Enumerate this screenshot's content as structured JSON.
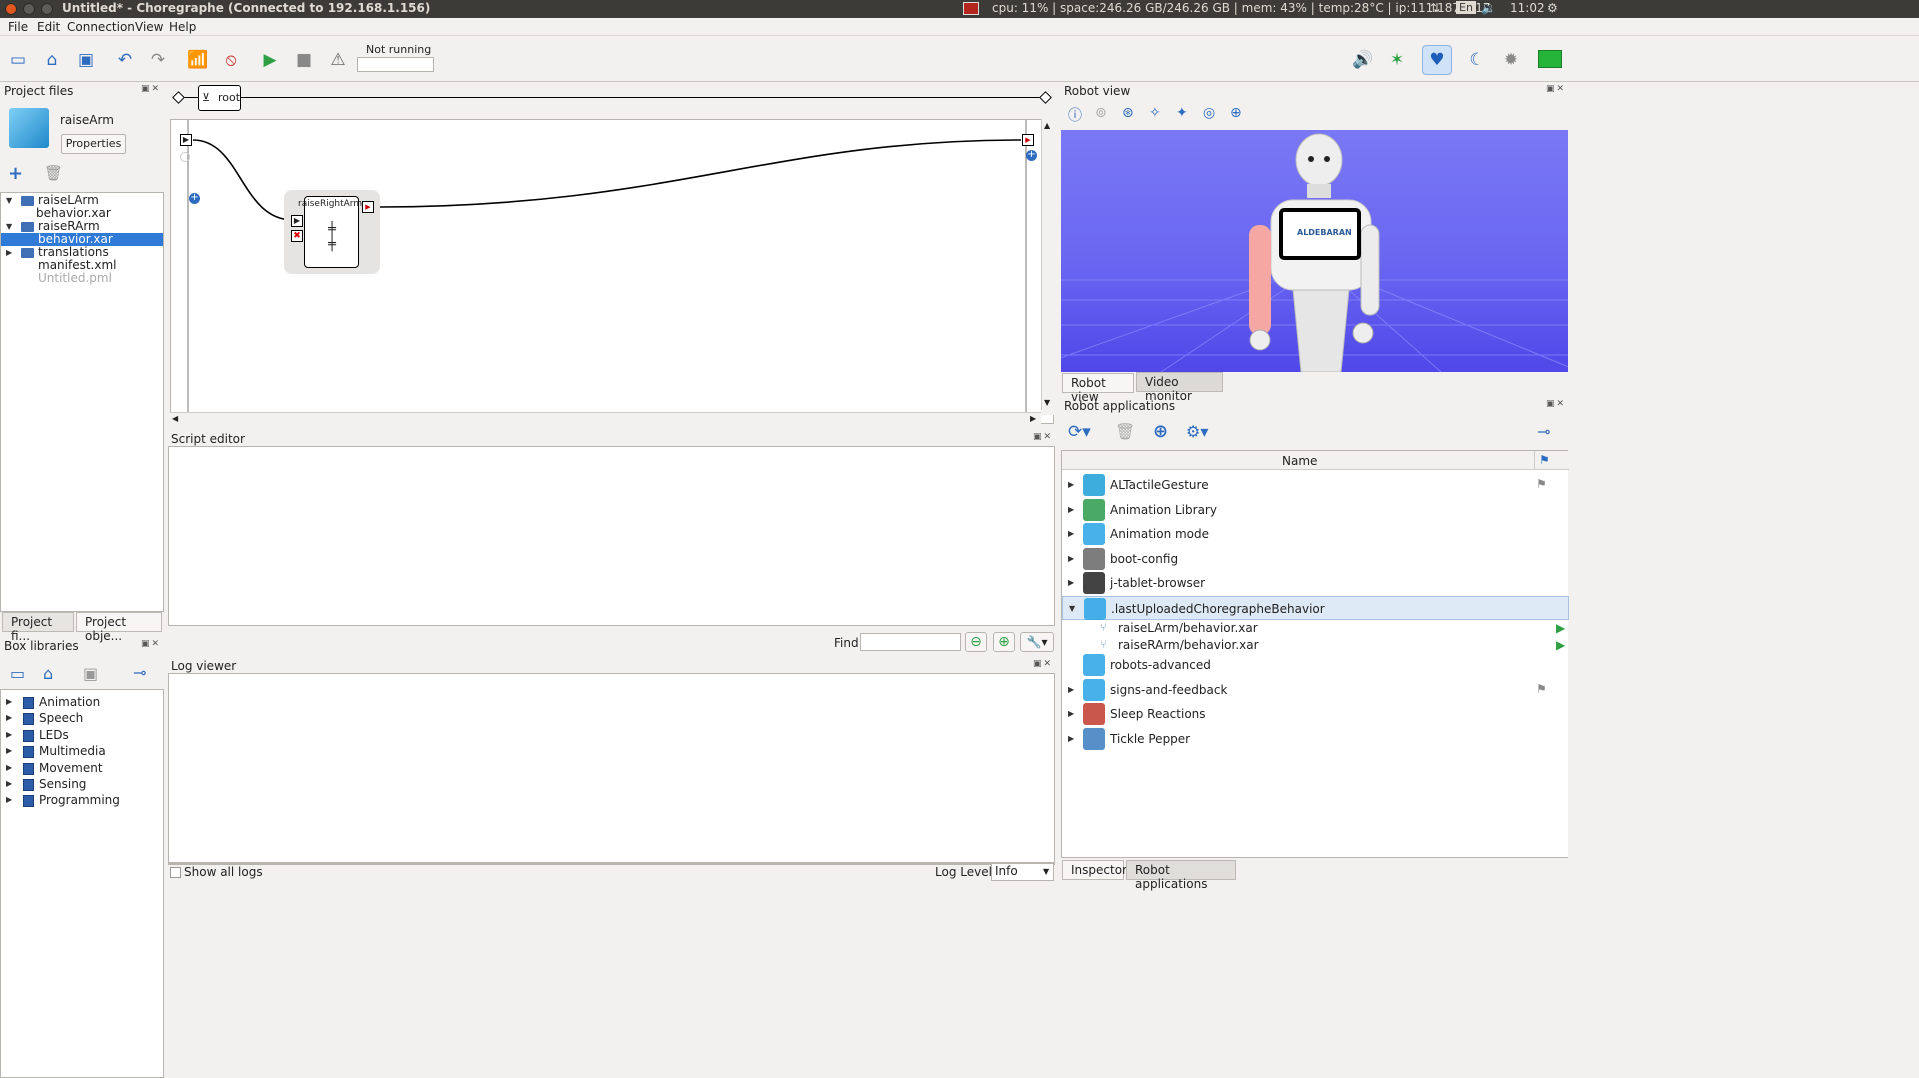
{
  "window": {
    "title": "Untitled* - Choregraphe (Connected to 192.168.1.156)",
    "tray_status": "cpu: 11% | space:246.26 GB/246.26 GB | mem: 43% | temp:28°C | ip:111.187.7.17",
    "tray_lang": "En",
    "tray_time": "11:02"
  },
  "menu": {
    "file": "File",
    "edit": "Edit",
    "connection": "Connection",
    "view": "View",
    "help": "Help"
  },
  "toolbar": {
    "status": "Not running"
  },
  "project_files": {
    "title": "Project files",
    "project_name": "raiseArm",
    "properties_button": "Properties",
    "tree": [
      {
        "label": "raiseLArm",
        "kind": "folder",
        "expanded": true,
        "indent": 0
      },
      {
        "label": "behavior.xar",
        "kind": "file",
        "indent": 1
      },
      {
        "label": "raiseRArm",
        "kind": "folder",
        "expanded": true,
        "indent": 0
      },
      {
        "label": "behavior.xar",
        "kind": "file",
        "indent": 1,
        "selected": true
      },
      {
        "label": "translations",
        "kind": "folder",
        "expanded": false,
        "indent": 0
      },
      {
        "label": "manifest.xml",
        "kind": "file",
        "indent": 0
      },
      {
        "label": "Untitled.pml",
        "kind": "file",
        "indent": 0,
        "dim": true
      }
    ],
    "tabs": [
      "Project fi...",
      "Project obje..."
    ]
  },
  "box_libraries": {
    "title": "Box libraries",
    "items": [
      "Animation",
      "Speech",
      "LEDs",
      "Multimedia",
      "Movement",
      "Sensing",
      "Programming"
    ]
  },
  "flow": {
    "root_label": "root",
    "box_label": "raiseRightArm"
  },
  "script_editor": {
    "title": "Script editor",
    "find_label": "Find:"
  },
  "log_viewer": {
    "title": "Log viewer",
    "show_all_logs": "Show all logs",
    "log_level_label": "Log Level:",
    "log_level_value": "Info"
  },
  "robot_view": {
    "title": "Robot view",
    "tabs": [
      "Robot view",
      "Video monitor"
    ],
    "tablet_text": "ALDEBARAN"
  },
  "robot_apps": {
    "title": "Robot applications",
    "column_name": "Name",
    "apps": [
      {
        "name": "ALTactileGesture",
        "expandable": true,
        "flag": true,
        "color": "#1a9fd6"
      },
      {
        "name": "Animation Library",
        "expandable": true,
        "flag": false,
        "color": "#2a9b4a"
      },
      {
        "name": "Animation mode",
        "expandable": true,
        "flag": false,
        "color": "#29a3e6"
      },
      {
        "name": "boot-config",
        "expandable": true,
        "flag": false,
        "color": "#666666"
      },
      {
        "name": "j-tablet-browser",
        "expandable": true,
        "flag": false,
        "color": "#222222"
      },
      {
        "name": ".lastUploadedChoregrapheBehavior",
        "expandable": true,
        "expanded": true,
        "flag": false,
        "color": "#29a3e6",
        "selected": true
      },
      {
        "name": "raiseLArm/behavior.xar",
        "child": true,
        "play": true
      },
      {
        "name": "raiseRArm/behavior.xar",
        "child": true,
        "play": true
      },
      {
        "name": "robots-advanced",
        "expandable": false,
        "flag": false,
        "color": "#29a3e6"
      },
      {
        "name": "signs-and-feedback",
        "expandable": true,
        "flag": true,
        "color": "#29a3e6"
      },
      {
        "name": "Sleep Reactions",
        "expandable": true,
        "flag": false,
        "color": "#c0392b"
      },
      {
        "name": "Tickle Pepper",
        "expandable": true,
        "flag": false,
        "color": "#3a7bc0"
      }
    ],
    "bottom_tabs": [
      "Inspector",
      "Robot applications"
    ]
  }
}
